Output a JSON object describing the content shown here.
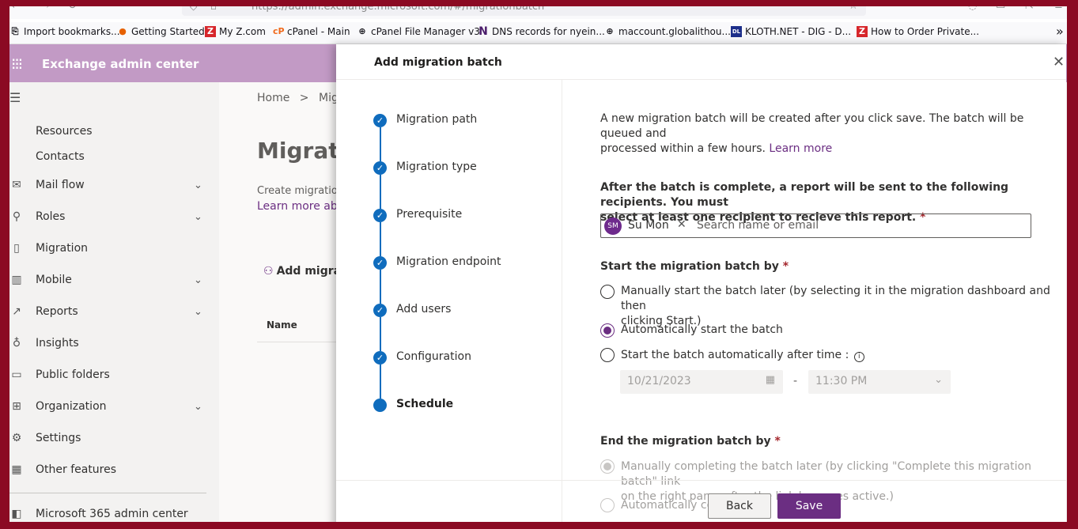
{
  "browser": {
    "url": "https://admin.exchange.microsoft.com/#/migrationbatch",
    "bookmarks": [
      {
        "label": "Import bookmarks...",
        "icon": "import-icon"
      },
      {
        "label": "Getting Started",
        "icon": "firefox-icon"
      },
      {
        "label": "My Z.com",
        "icon": "z-logo-icon"
      },
      {
        "label": "cPanel - Main",
        "icon": "cpanel-icon"
      },
      {
        "label": "cPanel File Manager v3",
        "icon": "globe-icon"
      },
      {
        "label": "DNS records for nyein...",
        "icon": "n-logo-icon"
      },
      {
        "label": "maccount.globalithou...",
        "icon": "globe-icon"
      },
      {
        "label": "KLOTH.NET - DIG - D...",
        "icon": "kloth-icon"
      },
      {
        "label": "How to Order Private...",
        "icon": "z-logo-icon"
      }
    ],
    "overflow": "»"
  },
  "suite": {
    "title": "Exchange admin center"
  },
  "nav": {
    "items": [
      {
        "label": "Resources",
        "icon": "",
        "chev": ""
      },
      {
        "label": "Contacts",
        "icon": "",
        "chev": ""
      },
      {
        "label": "Mail flow",
        "icon": "mail-icon",
        "chev": "⌄"
      },
      {
        "label": "Roles",
        "icon": "roles-icon",
        "chev": "⌄"
      },
      {
        "label": "Migration",
        "icon": "migration-icon",
        "chev": ""
      },
      {
        "label": "Mobile",
        "icon": "mobile-icon",
        "chev": "⌄"
      },
      {
        "label": "Reports",
        "icon": "reports-icon",
        "chev": "⌄"
      },
      {
        "label": "Insights",
        "icon": "insights-icon",
        "chev": ""
      },
      {
        "label": "Public folders",
        "icon": "folder-icon",
        "chev": ""
      },
      {
        "label": "Organization",
        "icon": "organization-icon",
        "chev": "⌄"
      },
      {
        "label": "Settings",
        "icon": "gear-icon",
        "chev": ""
      },
      {
        "label": "Other features",
        "icon": "grid-icon",
        "chev": ""
      },
      {
        "label": "Microsoft 365 admin center",
        "icon": "office-icon",
        "chev": ""
      }
    ]
  },
  "background": {
    "breadcrumb_home": "Home",
    "breadcrumb_sep": ">",
    "breadcrumb_current": "Migra",
    "page_title": "Migratio",
    "desc": "Create migration",
    "desc_link": "Learn more abou",
    "add_button": "Add migrat",
    "col_name": "Name"
  },
  "panel": {
    "title": "Add migration batch",
    "close": "✕",
    "steps": [
      {
        "label": "Migration path",
        "done": true
      },
      {
        "label": "Migration type",
        "done": true
      },
      {
        "label": "Prerequisite",
        "done": true
      },
      {
        "label": "Migration endpoint",
        "done": true
      },
      {
        "label": "Add users",
        "done": true
      },
      {
        "label": "Configuration",
        "done": true
      },
      {
        "label": "Schedule",
        "done": false
      }
    ],
    "intro_line1": "A new migration batch will be created after you click save. The batch will be queued and",
    "intro_line2": "processed within a few hours.",
    "learn_more": "Learn more",
    "recipients_line1": "After the batch is complete, a report will be sent to the following recipients. You must",
    "recipients_line2": "select at least one recipient to recieve this report.",
    "required_mark": "*",
    "recipient": {
      "initials": "SM",
      "name": "Su Mon",
      "remove": "✕"
    },
    "recipient_placeholder": "Search name or email",
    "start_heading": "Start the migration batch by",
    "start_options": {
      "manual_line1": "Manually start the batch later (by selecting it in the migration dashboard and then",
      "manual_line2": "clicking Start.)",
      "auto": "Automatically start the batch",
      "after_time": "Start the batch automatically after time :"
    },
    "info_icon": "i",
    "date_value": "10/21/2023",
    "dash": "-",
    "time_value": "11:30 PM",
    "end_heading": "End the migration batch by",
    "end_options": {
      "manual_line1": "Manually completing the batch later (by clicking \"Complete this migration batch\" link",
      "manual_line2": "on the right pane, after the link becomes active.)",
      "auto": "Automatically com"
    },
    "back_label": "Back",
    "save_label": "Save"
  },
  "colors": {
    "accent": "#6b2e82",
    "step": "#0f6cbd",
    "suite": "#c29ac5",
    "frame": "#8b0a23"
  }
}
